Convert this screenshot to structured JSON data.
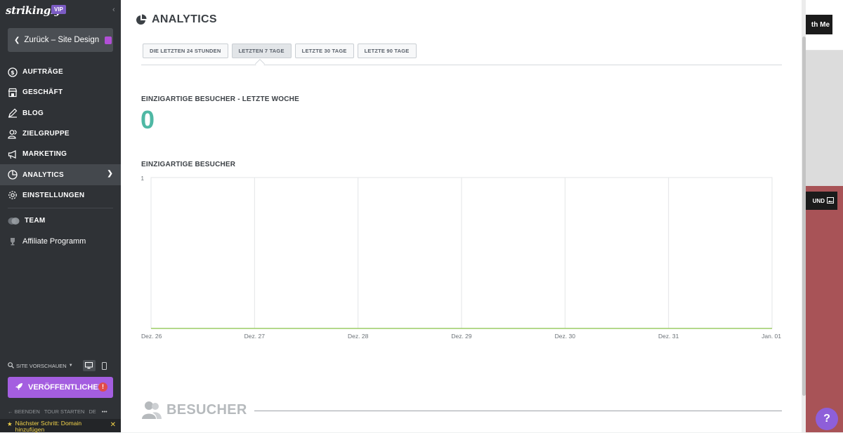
{
  "sidebar": {
    "logo": "strikingly",
    "vip_badge": "VIP",
    "back_button": "Zurück – Site Design",
    "items": [
      {
        "label": "AUFTRÄGE",
        "icon": "dollar-icon"
      },
      {
        "label": "GESCHÄFT",
        "icon": "store-icon"
      },
      {
        "label": "BLOG",
        "icon": "pen-icon"
      },
      {
        "label": "ZIELGRUPPE",
        "icon": "users-icon"
      },
      {
        "label": "MARKETING",
        "icon": "megaphone-icon"
      },
      {
        "label": "ANALYTICS",
        "icon": "pie-chart-icon",
        "active": true
      },
      {
        "label": "EINSTELLUNGEN",
        "icon": "gear-icon"
      }
    ],
    "team_label": "TEAM",
    "affiliate_label": "Affiliate Programm",
    "preview_label": "SITE VORSCHAUEN",
    "publish_label": "VERÖFFENTLICHEN",
    "publish_alert": "!",
    "footer": {
      "quit": "BEENDEN",
      "tour": "TOUR STARTEN",
      "lang": "DE",
      "more": "•••"
    },
    "next_step": "Nächster Schritt: Domain hinzufügen"
  },
  "background_site": {
    "cta_label": "th Me",
    "bg_button": "UND"
  },
  "help_label": "?",
  "analytics": {
    "title": "ANALYTICS",
    "tabs": [
      "DIE LETZTEN 24 STUNDEN",
      "LETZTEN 7 TAGE",
      "LETZTE 30 TAGE",
      "LETZTE 90 TAGE"
    ],
    "active_tab": 1,
    "unique_visitors_label": "EINZIGARTIGE BESUCHER - LETZTE WOCHE",
    "unique_visitors_value": "0",
    "chart_label": "EINZIGARTIGE BESUCHER",
    "section_title": "BESUCHER"
  },
  "colors": {
    "sidebar_bg": "#2f3236",
    "accent_purple": "#a45ee0",
    "teal_value": "#4fb8a4",
    "line_green": "#9ccc65"
  },
  "chart_data": {
    "type": "line",
    "title": "EINZIGARTIGE BESUCHER",
    "categories": [
      "Dez. 26",
      "Dez. 27",
      "Dez. 28",
      "Dez. 29",
      "Dez. 30",
      "Dez. 31",
      "Jan. 01"
    ],
    "values": [
      0,
      0,
      0,
      0,
      0,
      0,
      0
    ],
    "ylim": [
      0,
      1
    ],
    "yticks": [
      "1"
    ],
    "grid": true
  }
}
